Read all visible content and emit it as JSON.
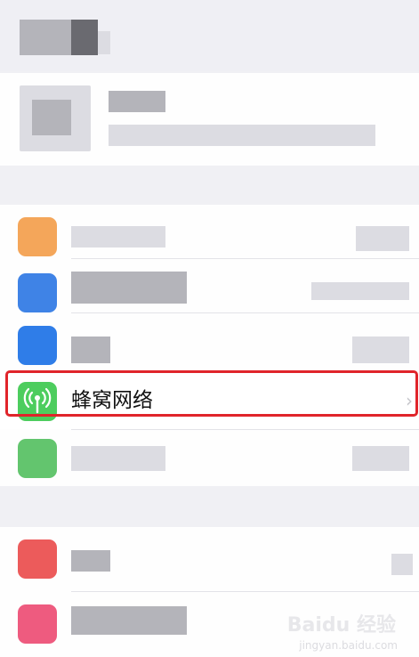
{
  "rows": {
    "cellular": {
      "label": "蜂窝网络",
      "icon": "antenna-icon",
      "icon_color": "#4dcd5e"
    }
  },
  "highlight": {
    "color": "#e0242a"
  },
  "watermark": {
    "logo": "Baidu 经验",
    "url": "jingyan.baidu.com"
  }
}
